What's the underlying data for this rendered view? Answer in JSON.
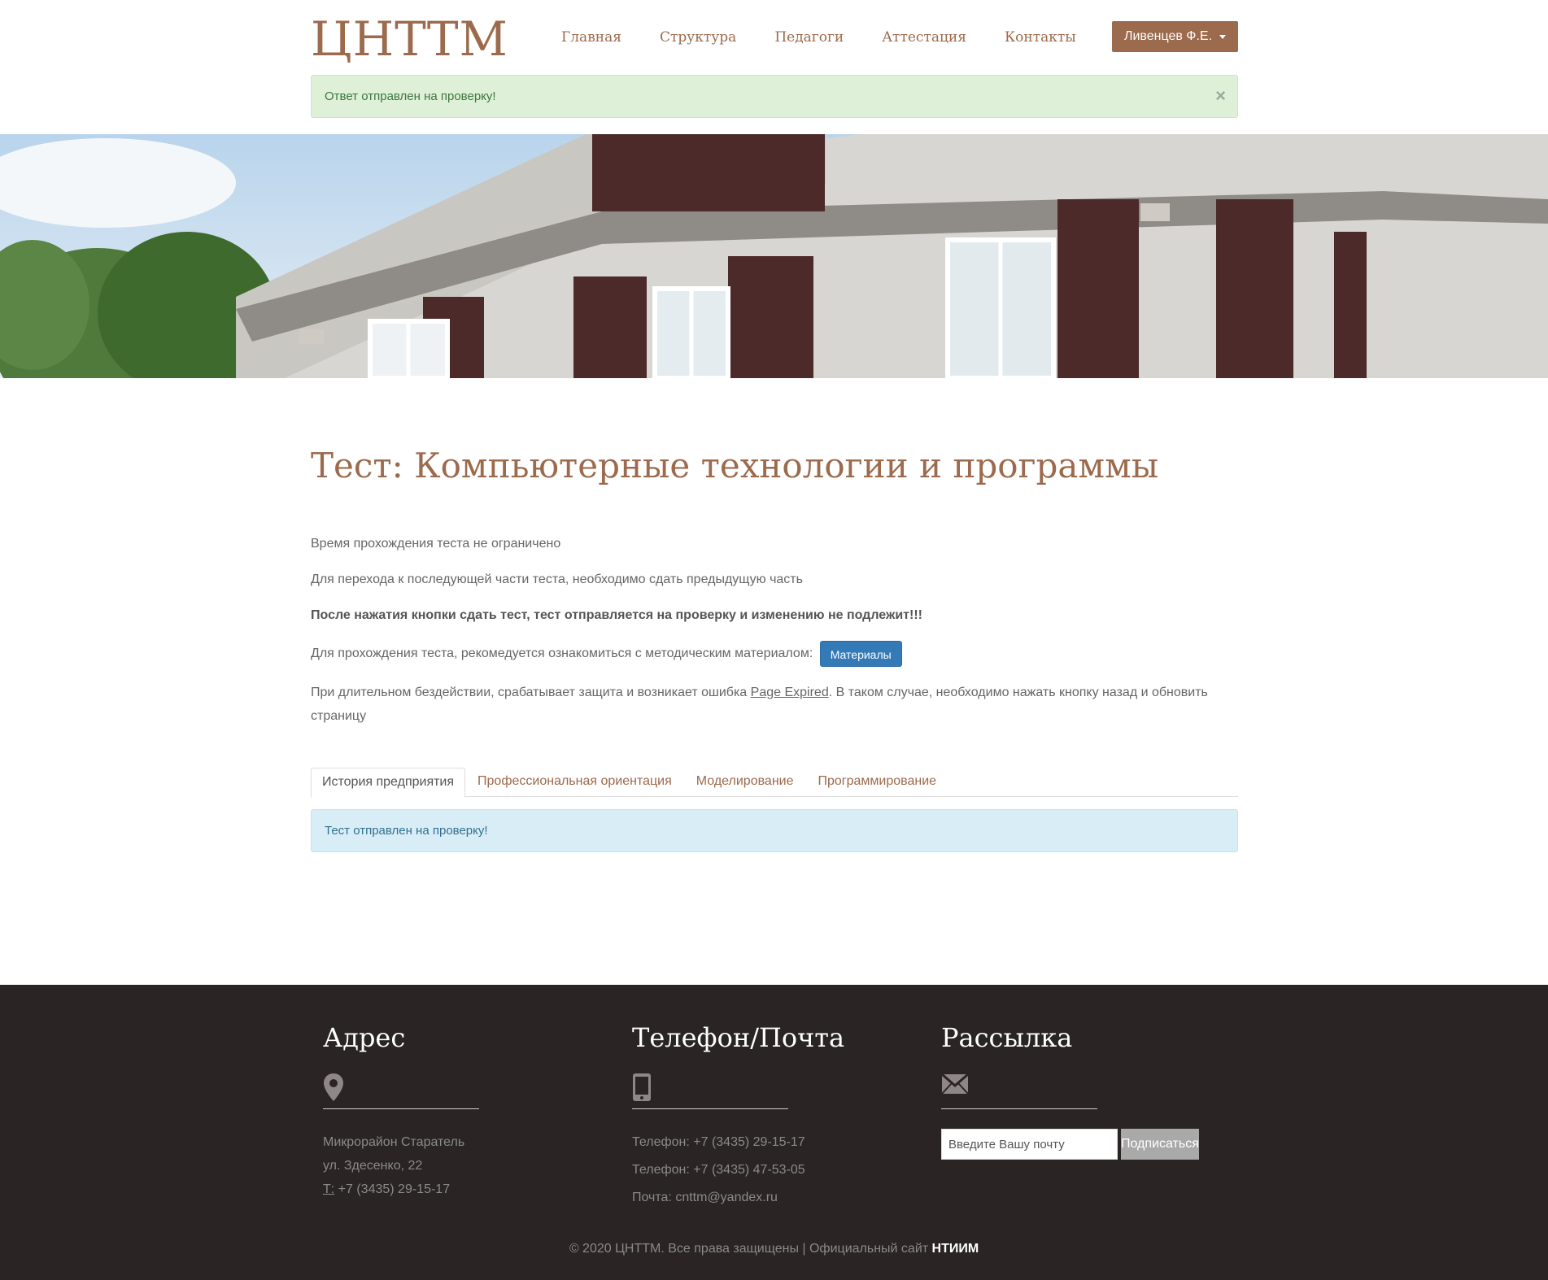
{
  "header": {
    "logo": "ЦНТТМ",
    "nav": [
      "Главная",
      "Структура",
      "Педагоги",
      "Аттестация",
      "Контакты"
    ],
    "user_menu": "Ливенцев Ф.Е."
  },
  "alert_success": {
    "text": "Ответ отправлен на проверку!",
    "close": "×"
  },
  "main": {
    "title": "Тест: Компьютерные технологии и программы",
    "line1": "Время прохождения теста не ограничено",
    "line2": "Для перехода к последующей части теста, необходимо сдать предыдущую часть",
    "line3": "После нажатия кнопки сдать тест, тест отправляется на проверку и изменению не подлежит!!!",
    "line4": "Для прохождения теста, рекомедуется ознакомиться с методическим материалом:",
    "materials_button": "Материалы",
    "line5_before": "При длительном бездействии, срабатывает защита и возникает ошибка ",
    "line5_link": "Page Expired",
    "line5_after": ". В таком случае, необходимо нажать кнопку назад и обновить страницу",
    "tabs": [
      "История предприятия",
      "Профессиональная ориентация",
      "Моделирование",
      "Программирование"
    ],
    "active_tab": "История предприятия",
    "info_alert": "Тест отправлен на проверку!"
  },
  "footer": {
    "address": {
      "title": "Адрес",
      "icon": "map-marker-icon",
      "line1": "Микрорайон Старатель",
      "line2": "ул. Здесенко, 22",
      "phone_label": "Т:",
      "phone": " +7 (3435) 29-15-17"
    },
    "contacts": {
      "title": "Телефон/Почта",
      "icon": "mobile-phone-icon",
      "phone1": "Телефон: +7 (3435) 29-15-17",
      "phone2": "Телефон: +7 (3435) 47-53-05",
      "email": "Почта: cnttm@yandex.ru"
    },
    "newsletter": {
      "title": "Рассылка",
      "icon": "envelope-icon",
      "placeholder": "Введите Вашу почту",
      "button": "Подписаться"
    },
    "copyright_text": "© 2020 ЦНТТМ. Все права защищены | Официальный сайт ",
    "copyright_link": "НТИИМ"
  },
  "colors": {
    "brand": "#9c6a4c",
    "footer_bg": "#2a2424",
    "primary_button": "#337ab7"
  }
}
